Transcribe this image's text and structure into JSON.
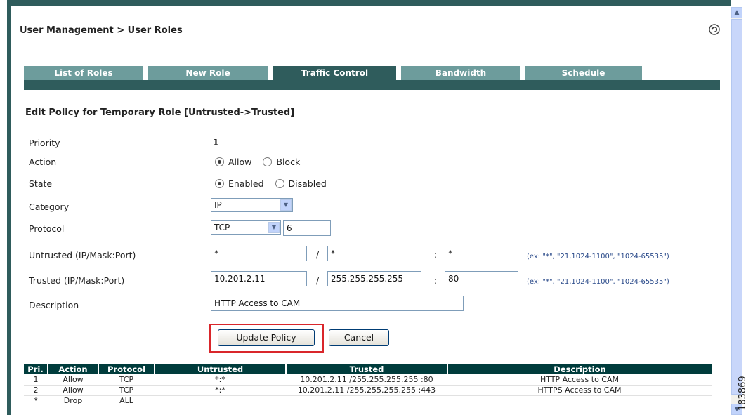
{
  "header": {
    "breadcrumb": "User Management > User Roles"
  },
  "tabs": [
    {
      "label": "List of Roles",
      "active": false
    },
    {
      "label": "New Role",
      "active": false
    },
    {
      "label": "Traffic Control",
      "active": true
    },
    {
      "label": "Bandwidth",
      "active": false
    },
    {
      "label": "Schedule",
      "active": false
    }
  ],
  "form": {
    "title": "Edit Policy for Temporary Role [Untrusted->Trusted]",
    "priority": {
      "label": "Priority",
      "value": "1"
    },
    "action": {
      "label": "Action",
      "options": [
        "Allow",
        "Block"
      ],
      "selected": "Allow"
    },
    "state": {
      "label": "State",
      "options": [
        "Enabled",
        "Disabled"
      ],
      "selected": "Enabled"
    },
    "category": {
      "label": "Category",
      "value": "IP"
    },
    "protocol": {
      "label": "Protocol",
      "value": "TCP",
      "number": "6"
    },
    "untrusted": {
      "label": "Untrusted (IP/Mask:Port)",
      "ip": "*",
      "mask": "*",
      "port": "*",
      "hint": "(ex: \"*\", \"21,1024-1100\", \"1024-65535\")"
    },
    "trusted": {
      "label": "Trusted (IP/Mask:Port)",
      "ip": "10.201.2.11",
      "mask": "255.255.255.255",
      "port": "80",
      "hint": "(ex: \"*\", \"21,1024-1100\", \"1024-65535\")"
    },
    "description": {
      "label": "Description",
      "value": "HTTP Access to CAM"
    },
    "separators": {
      "slash": "/",
      "colon": ":"
    },
    "update_label": "Update Policy",
    "cancel_label": "Cancel"
  },
  "policy_table": {
    "headers": [
      "Pri.",
      "Action",
      "Protocol",
      "Untrusted",
      "Trusted",
      "Description"
    ],
    "rows": [
      [
        "1",
        "Allow",
        "TCP",
        "*:*",
        "10.201.2.11 /255.255.255.255 :80",
        "HTTP Access to CAM"
      ],
      [
        "2",
        "Allow",
        "TCP",
        "*:*",
        "10.201.2.11 /255.255.255.255 :443",
        "HTTPS Access to CAM"
      ],
      [
        "*",
        "Drop",
        "ALL",
        "",
        "",
        ""
      ]
    ]
  },
  "figure_id": "183869",
  "colors": {
    "accent": "#2f5c5c",
    "tab_inactive": "#6d9c9c",
    "table_header": "#003c3c",
    "highlight": "#d9262b"
  }
}
